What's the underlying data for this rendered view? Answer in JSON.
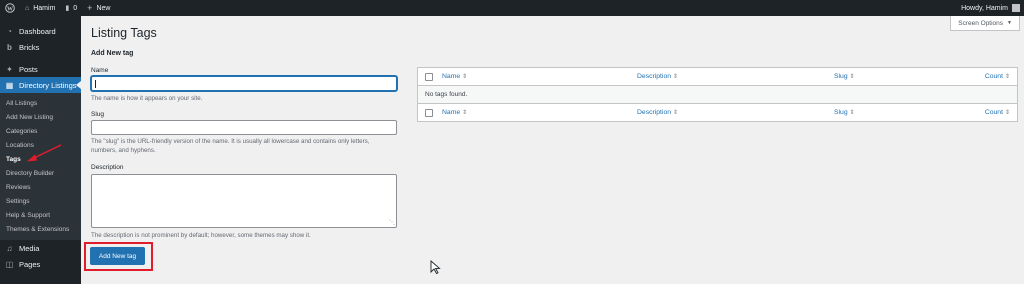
{
  "adminbar": {
    "site_name": "Hamim",
    "comments_count": "0",
    "new_label": "New",
    "howdy": "Howdy, Hamim"
  },
  "sidebar": {
    "dashboard": "Dashboard",
    "bricks": "Bricks",
    "posts": "Posts",
    "directory_listings": "Directory Listings",
    "submenu": [
      "All Listings",
      "Add New Listing",
      "Categories",
      "Locations",
      "Tags",
      "Directory Builder",
      "Reviews",
      "Settings",
      "Help & Support",
      "Themes & Extensions"
    ],
    "media": "Media",
    "pages": "Pages"
  },
  "screen_options": "Screen Options",
  "page_title": "Listing Tags",
  "form": {
    "title": "Add New tag",
    "name_label": "Name",
    "name_value": "",
    "name_help": "The name is how it appears on your site.",
    "slug_label": "Slug",
    "slug_value": "",
    "slug_help": "The \"slug\" is the URL-friendly version of the name. It is usually all lowercase and contains only letters, numbers, and hyphens.",
    "description_label": "Description",
    "description_value": "",
    "description_help": "The description is not prominent by default; however, some themes may show it.",
    "submit_label": "Add New tag"
  },
  "table": {
    "columns": [
      "Name",
      "Description",
      "Slug",
      "Count"
    ],
    "empty_message": "No tags found."
  },
  "colors": {
    "adminbar_bg": "#1d2327",
    "accent": "#2271b1",
    "highlight": "#e11d2c"
  }
}
